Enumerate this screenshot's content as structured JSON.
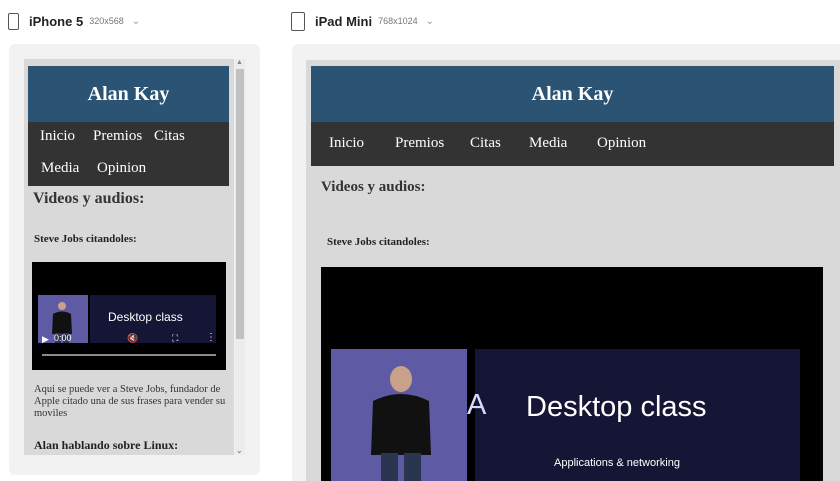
{
  "devices": {
    "iphone": {
      "name": "iPhone 5",
      "size": "320x568",
      "chevron": "⌄"
    },
    "ipad": {
      "name": "iPad Mini",
      "size": "768x1024",
      "chevron": "⌄"
    }
  },
  "site": {
    "title": "Alan Kay",
    "nav": [
      "Inicio",
      "Premios",
      "Citas",
      "Media",
      "Opinion"
    ],
    "section_title": "Videos y audios:",
    "video1_title": "Steve Jobs citandoles:",
    "video_slide_text": "Desktop class",
    "video_slide_subtitle": "Applications & networking",
    "video_slide_letter": "A",
    "video_time": "0:00",
    "video1_caption": "Aqui se puede ver a Steve Jobs, fundador de Apple citado una de sus frases para vender su moviles",
    "video2_title": "Alan hablando sobre Linux:"
  },
  "colors": {
    "header_bg": "#2b5474",
    "nav_bg": "#333333",
    "page_bg": "#d9d9d9"
  },
  "icons": {
    "play": "play-icon",
    "mute": "mute-icon",
    "fullscreen": "fullscreen-icon",
    "more": "more-icon",
    "device": "phone-icon"
  }
}
